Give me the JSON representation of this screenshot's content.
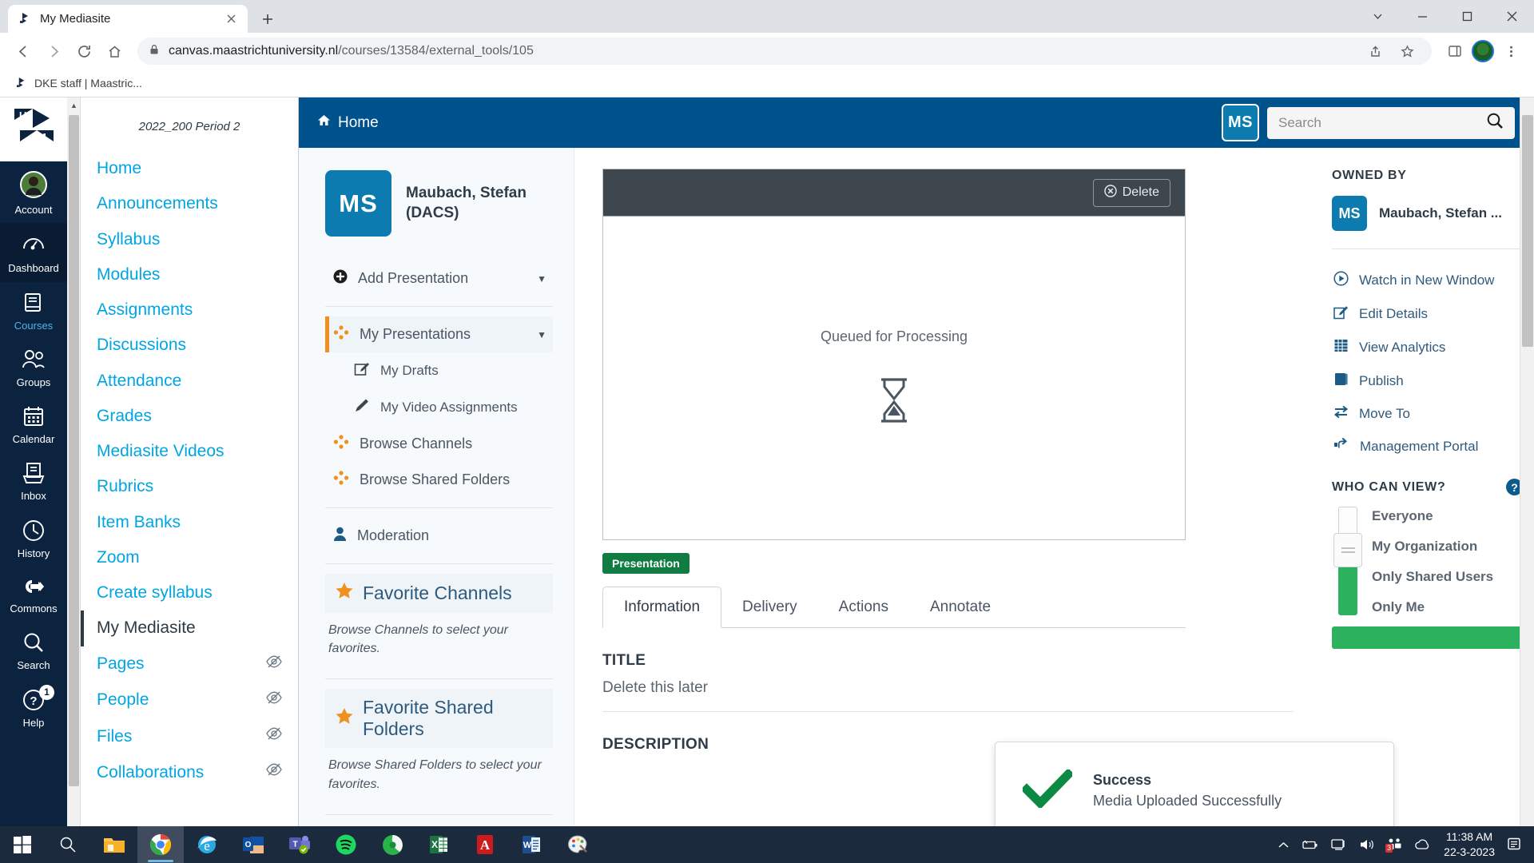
{
  "browser": {
    "tab": {
      "title": "My Mediasite",
      "favicon": "mediasite-icon",
      "close": "close-icon"
    },
    "new_tab_label": "+",
    "window_controls": {
      "minimize": "minimize-icon",
      "maximize": "maximize-icon",
      "close": "close-icon",
      "chevron": "chevron-down-icon"
    },
    "nav": {
      "back": "back-arrow-icon",
      "forward": "forward-arrow-icon",
      "reload": "reload-icon",
      "home": "home-icon"
    },
    "omnibox": {
      "lock": "lock-icon",
      "domain": "canvas.maastrichtuniversity.nl",
      "path": "/courses/13584/external_tools/105",
      "share": "share-icon",
      "bookmark": "star-icon",
      "sidepanel": "side-panel-icon",
      "menu": "kebab-menu-icon"
    },
    "bookmarks": [
      {
        "label": "DKE staff | Maastric...",
        "icon": "mediasite-icon"
      }
    ]
  },
  "global_nav": {
    "logo": "um-logo",
    "items": [
      {
        "label": "Account",
        "icon": "avatar-icon",
        "active": false
      },
      {
        "label": "Dashboard",
        "icon": "dashboard-icon",
        "active": true
      },
      {
        "label": "Courses",
        "icon": "courses-icon",
        "active": false
      },
      {
        "label": "Groups",
        "icon": "groups-icon",
        "active": false
      },
      {
        "label": "Calendar",
        "icon": "calendar-icon",
        "active": false
      },
      {
        "label": "Inbox",
        "icon": "inbox-icon",
        "active": false
      },
      {
        "label": "History",
        "icon": "history-icon",
        "active": false
      },
      {
        "label": "Commons",
        "icon": "commons-icon",
        "active": false
      },
      {
        "label": "Search",
        "icon": "search-icon",
        "active": false
      },
      {
        "label": "Help",
        "icon": "help-icon",
        "active": false,
        "badge": "1"
      }
    ]
  },
  "course_nav": {
    "term": "2022_200 Period 2",
    "items": [
      {
        "label": "Home",
        "hidden": false,
        "active": false
      },
      {
        "label": "Announcements",
        "hidden": false,
        "active": false
      },
      {
        "label": "Syllabus",
        "hidden": false,
        "active": false
      },
      {
        "label": "Modules",
        "hidden": false,
        "active": false
      },
      {
        "label": "Assignments",
        "hidden": false,
        "active": false
      },
      {
        "label": "Discussions",
        "hidden": false,
        "active": false
      },
      {
        "label": "Attendance",
        "hidden": false,
        "active": false
      },
      {
        "label": "Grades",
        "hidden": false,
        "active": false
      },
      {
        "label": "Mediasite Videos",
        "hidden": false,
        "active": false
      },
      {
        "label": "Rubrics",
        "hidden": false,
        "active": false
      },
      {
        "label": "Item Banks",
        "hidden": false,
        "active": false
      },
      {
        "label": "Zoom",
        "hidden": false,
        "active": false
      },
      {
        "label": "Create syllabus",
        "hidden": false,
        "active": false
      },
      {
        "label": "My Mediasite",
        "hidden": false,
        "active": true
      },
      {
        "label": "Pages",
        "hidden": true,
        "active": false
      },
      {
        "label": "People",
        "hidden": true,
        "active": false
      },
      {
        "label": "Files",
        "hidden": true,
        "active": false
      },
      {
        "label": "Collaborations",
        "hidden": true,
        "active": false
      }
    ]
  },
  "mediasite": {
    "topbar": {
      "home_label": "Home",
      "home_icon": "home-icon",
      "avatar_initials": "MS",
      "search_placeholder": "Search",
      "search_value": "",
      "search_icon": "search-icon"
    },
    "left_panel": {
      "avatar_initials": "MS",
      "user_name": "Maubach, Stefan (DACS)",
      "add_presentation": {
        "label": "Add Presentation",
        "icon": "plus-circle-icon",
        "caret": "caret-down-icon"
      },
      "menu": [
        {
          "label": "My Presentations",
          "icon": "channel-dots-icon",
          "selected": true,
          "caret": true,
          "sub": false
        },
        {
          "label": "My Drafts",
          "icon": "draft-edit-icon",
          "selected": false,
          "caret": false,
          "sub": true
        },
        {
          "label": "My Video Assignments",
          "icon": "pencil-icon",
          "selected": false,
          "caret": false,
          "sub": true
        },
        {
          "label": "Browse Channels",
          "icon": "channel-dots-icon",
          "selected": false,
          "caret": false,
          "sub": false
        },
        {
          "label": "Browse Shared Folders",
          "icon": "channel-dots-icon",
          "selected": false,
          "caret": false,
          "sub": false
        }
      ],
      "moderation": {
        "label": "Moderation",
        "icon": "person-icon"
      },
      "favorites": [
        {
          "title": "Favorite Channels",
          "icon": "star-icon",
          "note": "Browse Channels to select your favorites."
        },
        {
          "title": "Favorite Shared Folders",
          "icon": "star-icon",
          "note": "Browse Shared Folders to select your favorites."
        }
      ]
    },
    "player": {
      "delete_label": "Delete",
      "delete_icon": "delete-circle-icon",
      "status_text": "Queued for Processing",
      "status_icon": "hourglass-icon",
      "badge": "Presentation"
    },
    "tabs": [
      {
        "label": "Information",
        "active": true
      },
      {
        "label": "Delivery",
        "active": false
      },
      {
        "label": "Actions",
        "active": false
      },
      {
        "label": "Annotate",
        "active": false
      }
    ],
    "fields": [
      {
        "label": "TITLE",
        "value": "Delete this later"
      },
      {
        "label": "DESCRIPTION",
        "value": ""
      }
    ],
    "right_rail": {
      "owned_by_label": "OWNED BY",
      "owner_initials": "MS",
      "owner_name": "Maubach, Stefan ...",
      "actions": [
        {
          "label": "Watch in New Window",
          "icon": "play-circle-icon"
        },
        {
          "label": "Edit Details",
          "icon": "edit-square-icon"
        },
        {
          "label": "View Analytics",
          "icon": "analytics-icon"
        },
        {
          "label": "Publish",
          "icon": "publish-book-icon"
        },
        {
          "label": "Move To",
          "icon": "move-arrows-icon"
        },
        {
          "label": "Management Portal",
          "icon": "pointing-hand-icon"
        }
      ],
      "who_can_view_label": "WHO CAN VIEW?",
      "help_icon": "question-mark-icon",
      "visibility_options": [
        "Everyone",
        "My Organization",
        "Only Shared Users",
        "Only Me"
      ]
    },
    "toast": {
      "icon": "checkmark-icon",
      "title": "Success",
      "message": "Media Uploaded Successfully"
    }
  },
  "taskbar": {
    "start_icon": "windows-start-icon",
    "search_icon": "search-icon",
    "apps": [
      {
        "name": "file-explorer-icon",
        "active": false
      },
      {
        "name": "google-chrome-icon",
        "active": true
      },
      {
        "name": "internet-explorer-icon",
        "active": false
      },
      {
        "name": "outlook-icon",
        "active": false
      },
      {
        "name": "microsoft-teams-icon",
        "active": false
      },
      {
        "name": "spotify-icon",
        "active": false
      },
      {
        "name": "firefox-icon",
        "active": false
      },
      {
        "name": "excel-icon",
        "active": false
      },
      {
        "name": "adobe-acrobat-icon",
        "active": false
      },
      {
        "name": "word-icon",
        "active": false
      },
      {
        "name": "paint-icon",
        "active": false
      }
    ],
    "tray": {
      "chevron": "chevron-up-icon",
      "battery": "battery-icon",
      "network": "network-icon",
      "volume": "volume-icon",
      "teams": "teams-tray-icon",
      "teams_badge": "3",
      "onedrive": "onedrive-icon",
      "notifications": "notification-icon"
    },
    "clock": {
      "time": "11:38 AM",
      "date": "22-3-2023"
    }
  }
}
